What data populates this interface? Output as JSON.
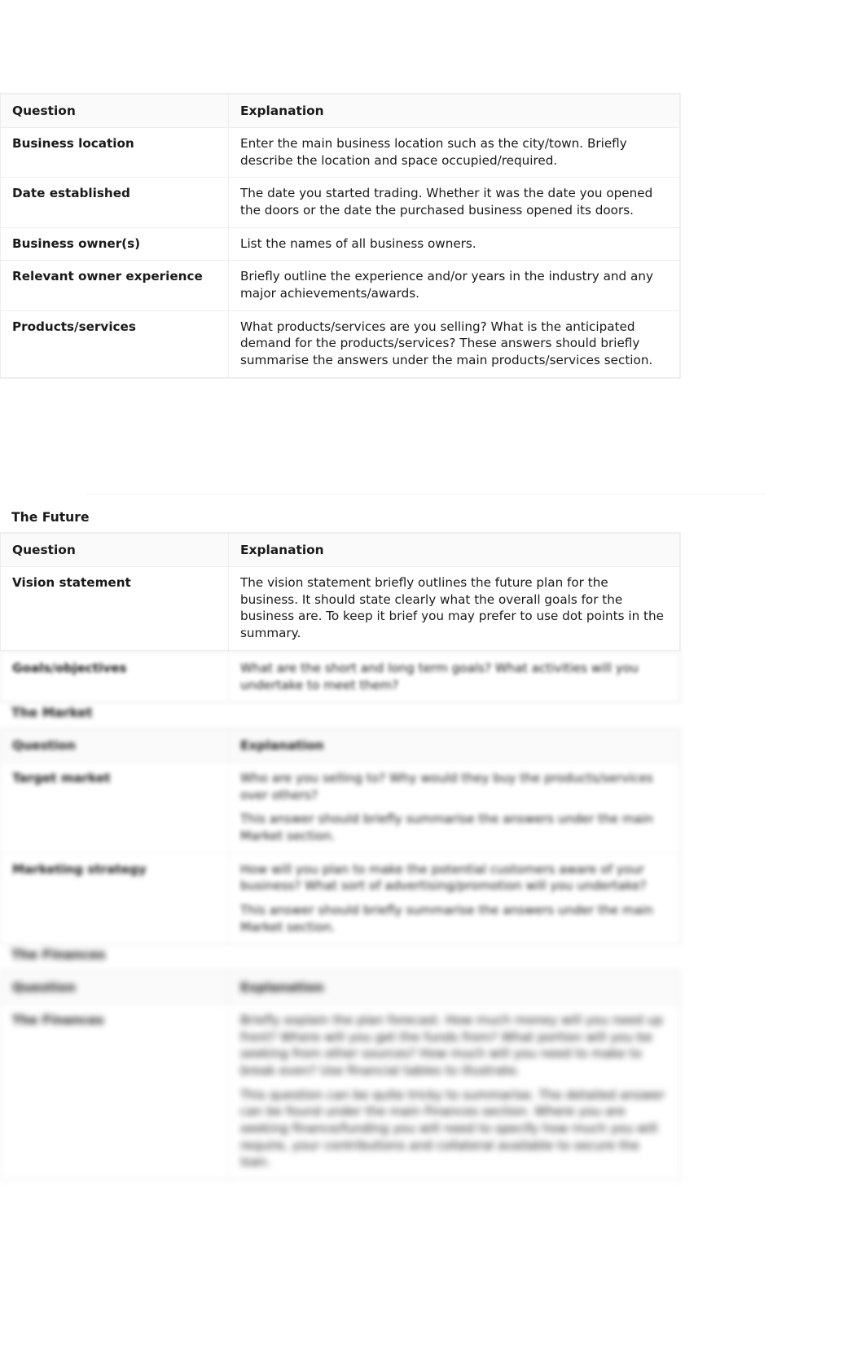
{
  "document": {
    "columns": {
      "question": "Question",
      "explanation": "Explanation"
    },
    "sections": [
      {
        "id": "business-details",
        "heading": "",
        "rows": [
          {
            "question": "Business location",
            "paragraphs": [
              "Enter the main business location such as the city/town. Briefly describe the location and space occupied/required."
            ]
          },
          {
            "question": "Date established",
            "paragraphs": [
              "The date you started trading. Whether it was the date you opened the doors or the date the purchased business opened its doors."
            ]
          },
          {
            "question": "Business owner(s)",
            "paragraphs": [
              "List the names of all business owners."
            ]
          },
          {
            "question": "Relevant owner experience",
            "paragraphs": [
              "Briefly outline the experience and/or years in the industry and any major achievements/awards."
            ]
          },
          {
            "question": "Products/services",
            "paragraphs": [
              "What products/services are you selling? What is the anticipated demand for the products/services? These answers should briefly summarise the answers under the main products/services section."
            ]
          }
        ]
      },
      {
        "id": "the-future",
        "heading": "The Future",
        "rows": [
          {
            "question": "Vision statement",
            "paragraphs": [
              "The vision statement briefly outlines the future plan for the business. It should state clearly what the overall goals for the business are. To keep it brief you may prefer to use dot points in the summary."
            ]
          },
          {
            "question": "Goals/objectives",
            "paragraphs": [
              "What are the short and long term goals? What activities will you undertake to meet them?"
            ]
          }
        ]
      },
      {
        "id": "the-market",
        "heading": "The Market",
        "rows": [
          {
            "question": "Target market",
            "paragraphs": [
              "Who are you selling to? Why would they buy the products/services over others?",
              "This answer should briefly summarise the answers under the main Market section."
            ]
          },
          {
            "question": "Marketing strategy",
            "paragraphs": [
              "How will you plan to make the potential customers aware of your business? What sort of advertising/promotion will you undertake?",
              "This answer should briefly summarise the answers under the main Market section."
            ]
          }
        ]
      },
      {
        "id": "the-finances",
        "heading": "The Finances",
        "rows": [
          {
            "question": "The Finances",
            "paragraphs": [
              "Briefly explain the plan forecast. How much money will you need up front? Where will you get the funds from? What portion will you be seeking from other sources? How much will you need to make to break even? Use financial tables to illustrate.",
              "This question can be quite tricky to summarise. The detailed answer can be found under the main Finances section. Where you are seeking finance/funding you will need to specify how much you will require, your contributions and collateral available to secure the loan."
            ]
          }
        ]
      }
    ]
  }
}
